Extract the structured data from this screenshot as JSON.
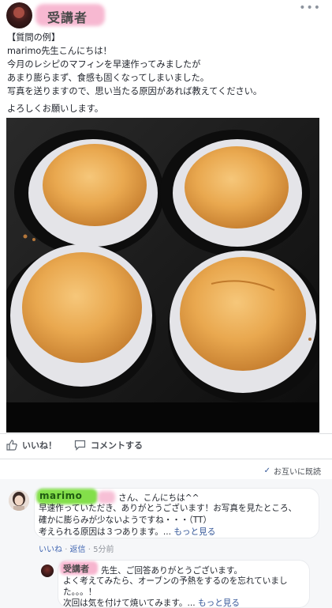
{
  "post": {
    "author": "受講者",
    "more": "•••",
    "lines": [
      "【質問の例】",
      "marimo先生こんにちは！",
      "今月のレシピのマフィンを早速作ってみましたが",
      "あまり膨らまず、食感も固くなってしまいました。",
      "写真を送りますので、思い当たる原因があれば教えてください。",
      "よろしくお願いします。"
    ],
    "photo_alt": "muffins in baking tray"
  },
  "actions": {
    "like_label": "いいね！",
    "comment_label": "コメントする",
    "seen_label": "お互いに既読"
  },
  "comments": [
    {
      "author": "marimo",
      "first_line": "さん、こんにちは^^",
      "lines": [
        "早速作っていただき、ありがとうございます！お写真を見たところ、",
        "確かに膨らみが少ないようですね・・・（TT）"
      ],
      "last_line": "考えられる原因は３つあります。...",
      "more": "もっと見る",
      "like": "いいね",
      "reply": "返信",
      "time": "5分前"
    },
    {
      "author": "受講者",
      "first_line": "先生、ご回答ありがとうございます。",
      "lines": [
        "よく考えてみたら、オーブンの予熱をするのを忘れていまし",
        "た。。。！"
      ],
      "last_line": "次回は気を付けて焼いてみます。...",
      "more": "もっと見る"
    }
  ],
  "colors": {
    "link": "#365899",
    "highlight_pink": "#f7b5cf",
    "highlight_green": "#83df4a"
  }
}
